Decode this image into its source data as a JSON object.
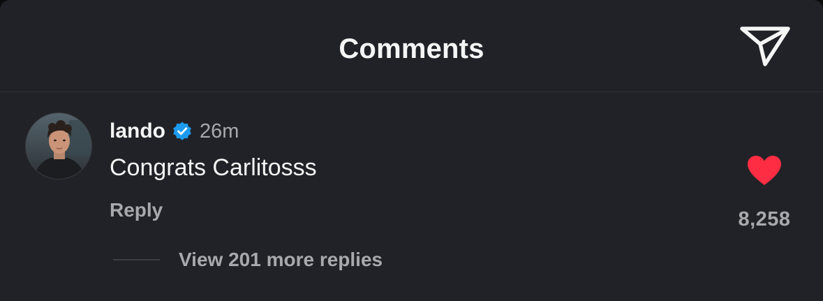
{
  "header": {
    "title": "Comments",
    "share_icon": "send-icon"
  },
  "comment": {
    "username": "lando",
    "verified_icon": "verified-badge-icon",
    "time": "26m",
    "text": "Congrats Carlitosss",
    "reply_label": "Reply",
    "like_icon": "heart-filled-icon",
    "like_count": "8,258",
    "view_replies_label": "View 201 more replies"
  },
  "colors": {
    "background": "#212227",
    "text_primary": "#f5f5f5",
    "text_secondary": "#a8a9ad",
    "verified": "#1d9bf0",
    "heart": "#ff2d43"
  }
}
